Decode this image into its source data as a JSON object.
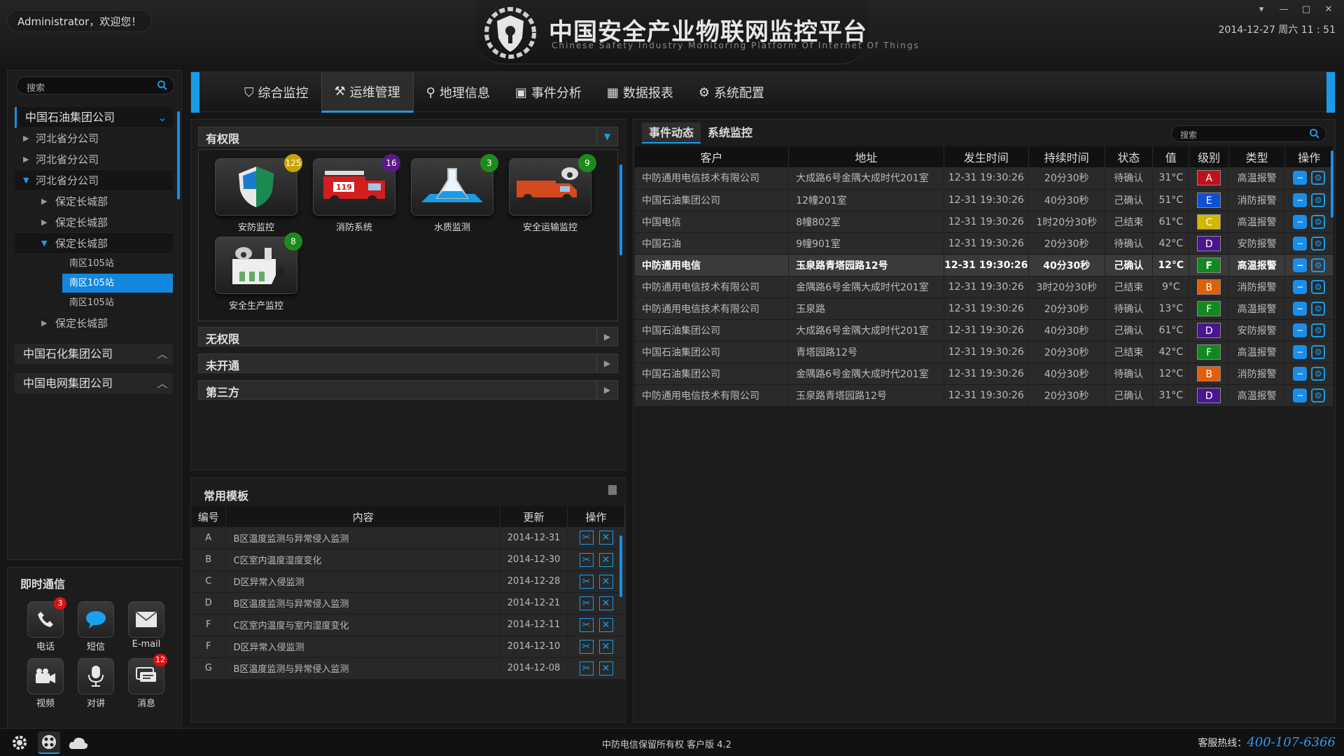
{
  "header": {
    "welcome": "Administrator，欢迎您！",
    "title_cn": "中国安全产业物联网监控平台",
    "title_en": "Chinese Safety Industry Monitoring Platform Of Internet Of Things",
    "datetime": "2014-12-27 周六 11 : 51",
    "window_controls": [
      "▾",
      "—",
      "□",
      "✕"
    ]
  },
  "sidebar": {
    "search_placeholder": "搜索",
    "tree": [
      {
        "label": "中国石油集团公司",
        "level": 0,
        "state": "expanded"
      },
      {
        "label": "河北省分公司",
        "level": 1,
        "state": "collapsed"
      },
      {
        "label": "河北省分公司",
        "level": 1,
        "state": "collapsed"
      },
      {
        "label": "河北省分公司",
        "level": 1,
        "state": "expanded"
      },
      {
        "label": "保定长城部",
        "level": 2,
        "state": "collapsed"
      },
      {
        "label": "保定长城部",
        "level": 2,
        "state": "collapsed"
      },
      {
        "label": "保定长城部",
        "level": 2,
        "state": "expanded"
      },
      {
        "label": "南区105站",
        "level": 3
      },
      {
        "label": "南区105站",
        "level": 3,
        "selected": true
      },
      {
        "label": "南区105站",
        "level": 3
      },
      {
        "label": "保定长城部",
        "level": 2,
        "state": "collapsed"
      }
    ],
    "groups": [
      "中国石化集团公司",
      "中国电网集团公司"
    ]
  },
  "comms": {
    "title": "即时通信",
    "items": [
      {
        "label": "电话",
        "icon": "phone-icon",
        "badge": "3"
      },
      {
        "label": "短信",
        "icon": "sms-icon",
        "badge": ""
      },
      {
        "label": "E-mail",
        "icon": "email-icon",
        "badge": ""
      },
      {
        "label": "视频",
        "icon": "video-icon",
        "badge": ""
      },
      {
        "label": "对讲",
        "icon": "microphone-icon",
        "badge": ""
      },
      {
        "label": "消息",
        "icon": "message-icon",
        "badge": "12"
      }
    ]
  },
  "nav": {
    "tabs": [
      {
        "label": "综合监控",
        "icon": "monitor-icon",
        "active": false
      },
      {
        "label": "运维管理",
        "icon": "tools-icon",
        "active": true
      },
      {
        "label": "地理信息",
        "icon": "location-icon",
        "active": false
      },
      {
        "label": "事件分析",
        "icon": "analysis-icon",
        "active": false
      },
      {
        "label": "数据报表",
        "icon": "table-icon",
        "active": false
      },
      {
        "label": "系统配置",
        "icon": "settings-icon",
        "active": false
      }
    ]
  },
  "permissions": {
    "has_perm": "有权限",
    "apps": [
      {
        "label": "安防监控",
        "icon": "shield-icon",
        "badge": "125",
        "badge_color": "#c9a400"
      },
      {
        "label": "消防系统",
        "icon": "fire-truck-icon",
        "badge": "16",
        "badge_color": "#5a1a8a"
      },
      {
        "label": "水质监测",
        "icon": "flask-icon",
        "badge": "3",
        "badge_color": "#1e8a1e"
      },
      {
        "label": "安全运输监控",
        "icon": "truck-icon",
        "badge": "9",
        "badge_color": "#1e8a1e"
      },
      {
        "label": "安全生产监控",
        "icon": "factory-camera-icon",
        "badge": "8",
        "badge_color": "#1e8a1e"
      }
    ],
    "no_perm": "无权限",
    "not_open": "未开通",
    "third_party": "第三方"
  },
  "templates": {
    "title": "常用模板",
    "columns": [
      "编号",
      "内容",
      "更新",
      "操作"
    ],
    "rows": [
      [
        "A",
        "B区温度监测与异常侵入监测",
        "2014-12-31"
      ],
      [
        "B",
        "C区室内温度湿度变化",
        "2014-12-30"
      ],
      [
        "C",
        "D区异常入侵监测",
        "2014-12-28"
      ],
      [
        "D",
        "B区温度监测与异常侵入监测",
        "2014-12-21"
      ],
      [
        "F",
        "C区室内温度与室内湿度变化",
        "2014-12-11"
      ],
      [
        "F",
        "D区异常入侵监测",
        "2014-12-10"
      ],
      [
        "G",
        "B区温度监测与异常侵入监测",
        "2014-12-08"
      ]
    ]
  },
  "events": {
    "tabs": [
      "事件动态",
      "系统监控"
    ],
    "search_placeholder": "搜索",
    "columns": [
      "客户",
      "地址",
      "发生时间",
      "持续时间",
      "状态",
      "值",
      "级别",
      "类型",
      "操作"
    ],
    "rows": [
      [
        "中防通用电信技术有限公司",
        "大成路6号金隅大成时代201室",
        "12-31 19:30:26",
        "20分30秒",
        "待确认",
        "31°C",
        "A",
        "高温报警"
      ],
      [
        "中国石油集团公司",
        "12幢201室",
        "12-31 19:30:26",
        "40分30秒",
        "己确认",
        "51°C",
        "E",
        "消防报警"
      ],
      [
        "中国电信",
        "8幢802室",
        "12-31 19:30:26",
        "1时20分30秒",
        "己结束",
        "61°C",
        "C",
        "高温报警"
      ],
      [
        "中国石油",
        "9幢901室",
        "12-31 19:30:26",
        "20分30秒",
        "待确认",
        "42°C",
        "D",
        "安防报警"
      ],
      [
        "中防通用电信",
        "玉泉路青塔园路12号",
        "12-31 19:30:26",
        "40分30秒",
        "己确认",
        "12°C",
        "F",
        "高温报警"
      ],
      [
        "中防通用电信技术有限公司",
        "金隅路6号金隅大成时代201室",
        "12-31 19:30:26",
        "3时20分30秒",
        "己结束",
        "9°C",
        "B",
        "消防报警"
      ],
      [
        "中防通用电信技术有限公司",
        "玉泉路",
        "12-31 19:30:26",
        "20分30秒",
        "待确认",
        "13°C",
        "F",
        "高温报警"
      ],
      [
        "中国石油集团公司",
        "大成路6号金隅大成时代201室",
        "12-31 19:30:26",
        "40分30秒",
        "己确认",
        "61°C",
        "D",
        "安防报警"
      ],
      [
        "中国石油集团公司",
        "青塔园路12号",
        "12-31 19:30:26",
        "20分30秒",
        "己结束",
        "42°C",
        "F",
        "高温报警"
      ],
      [
        "中国石油集团公司",
        "金隅路6号金隅大成时代201室",
        "12-31 19:30:26",
        "40分30秒",
        "待确认",
        "12°C",
        "B",
        "消防报警"
      ],
      [
        "中防通用电信技术有限公司",
        "玉泉路青塔园路12号",
        "12-31 19:30:26",
        "20分30秒",
        "己确认",
        "31°C",
        "D",
        "高温报警"
      ]
    ],
    "highlight_row": 4,
    "level_colors": {
      "A": "#c0101a",
      "B": "#e0600a",
      "C": "#d4b800",
      "D": "#4a1590",
      "E": "#1050d0",
      "F": "#108a20"
    }
  },
  "footer": {
    "copyright": "中防电信保留所有权  客户版 4.2",
    "hotline_label": "客服热线：",
    "hotline": "400-107-6366"
  }
}
